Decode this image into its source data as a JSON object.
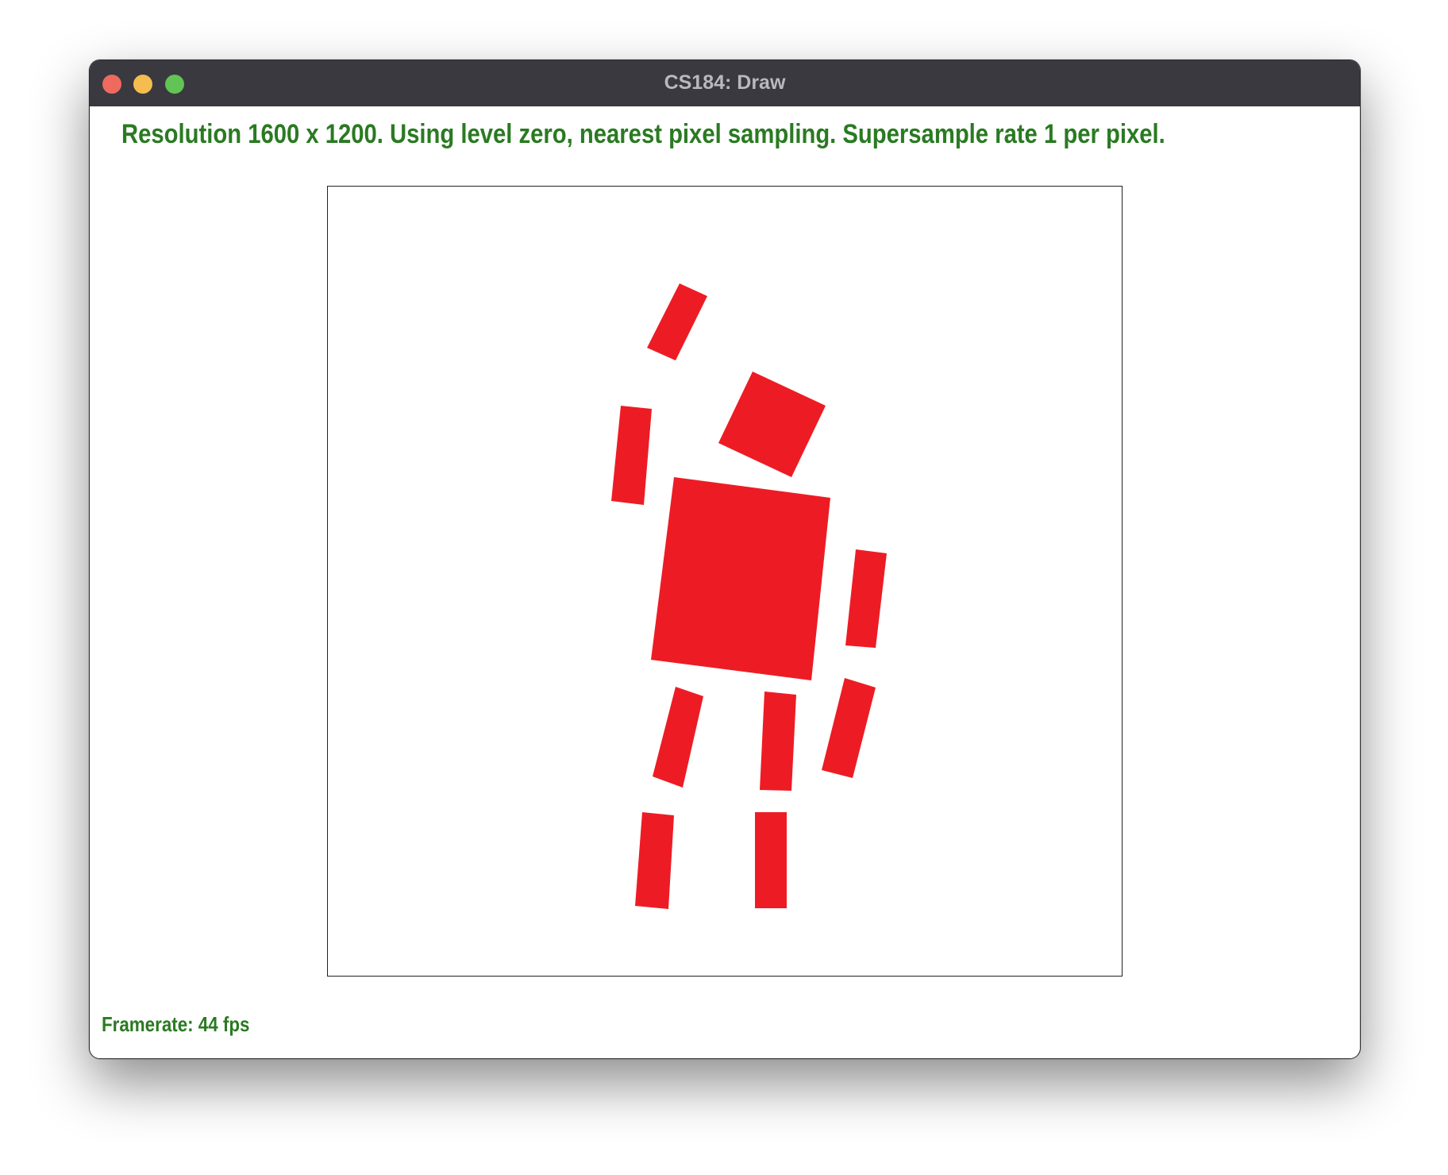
{
  "window": {
    "title": "CS184: Draw"
  },
  "status": {
    "text": "Resolution 1600 x 1200. Using level zero, nearest pixel sampling. Supersample rate 1 per pixel."
  },
  "footer": {
    "framerate": "Framerate: 44 fps"
  },
  "colors": {
    "shape_fill": "#ed1c24",
    "status_text": "#2a7a22",
    "titlebar": "#3a393f"
  }
}
